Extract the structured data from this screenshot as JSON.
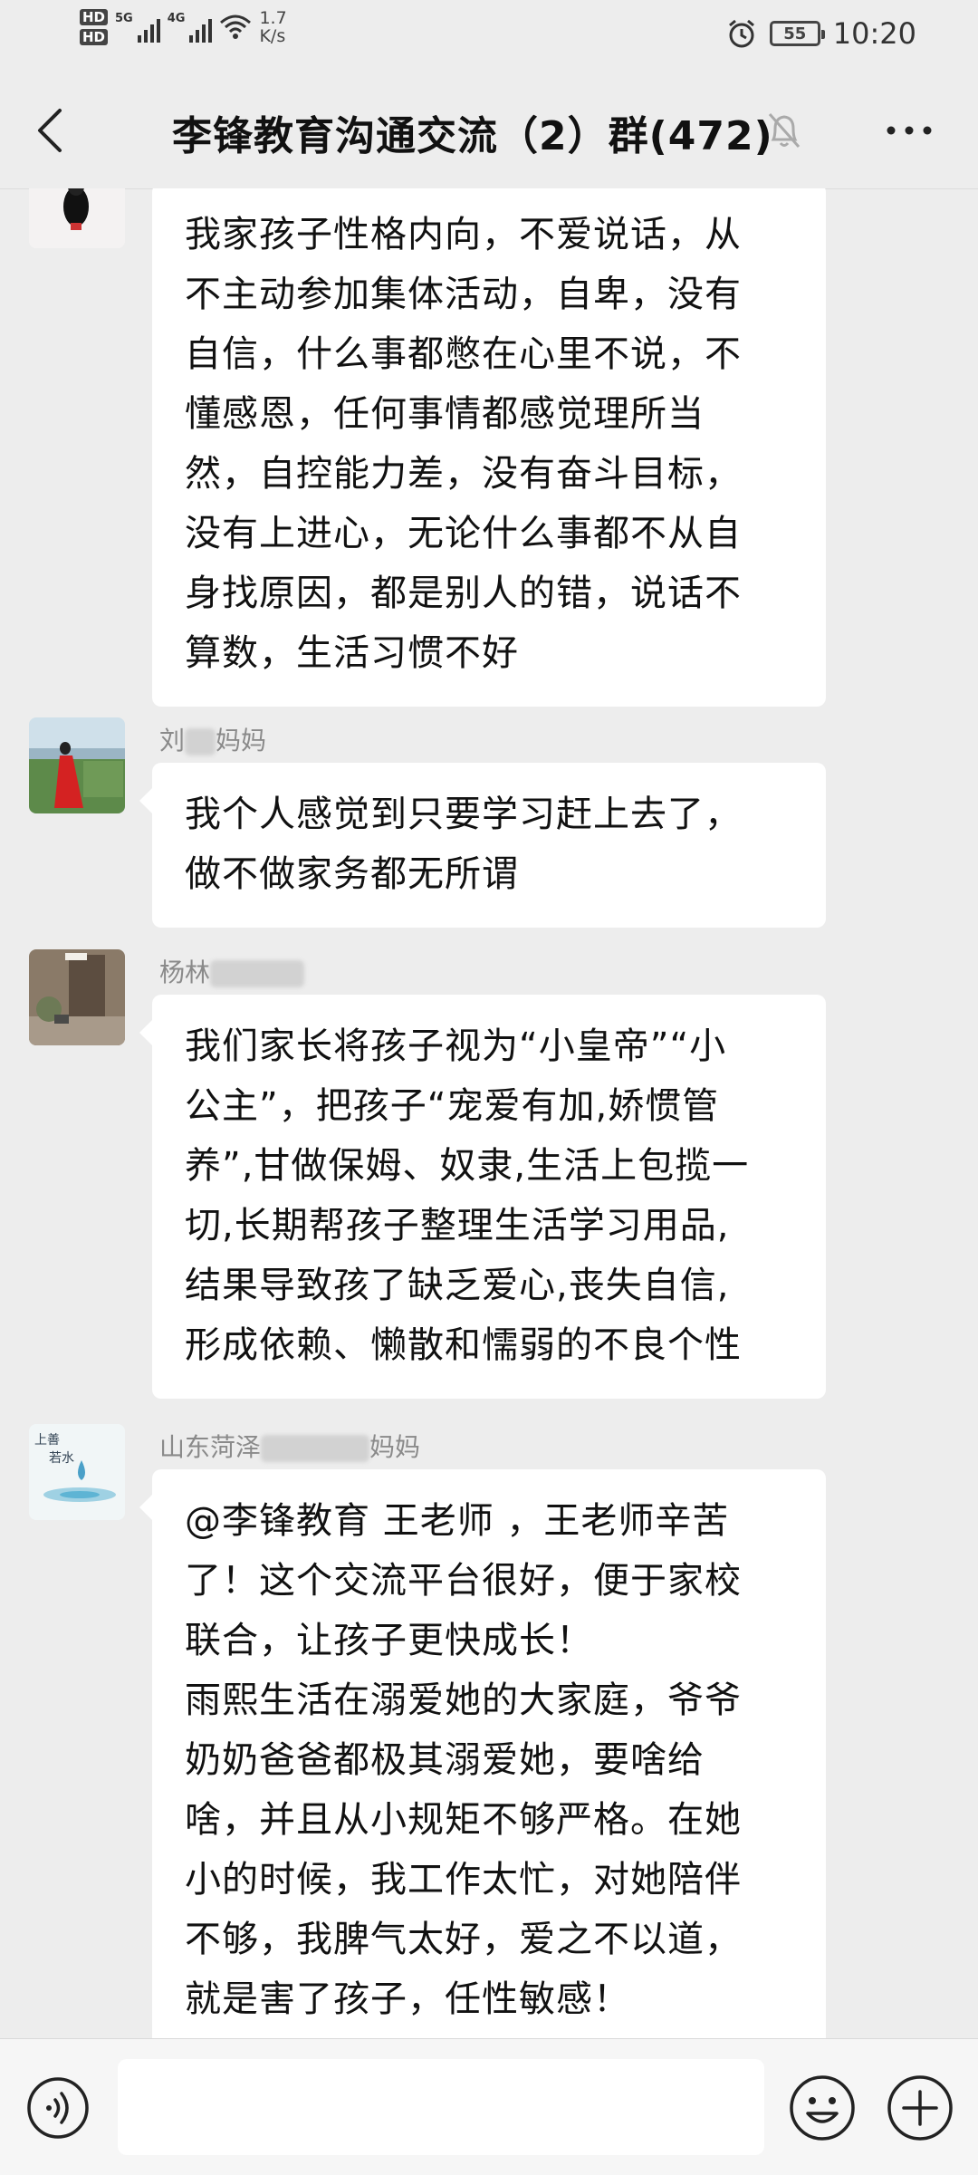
{
  "status_bar": {
    "hd1": "HD",
    "hd2": "HD",
    "net1": "5G",
    "net2": "4G",
    "speed_value": "1.7",
    "speed_unit": "K/s",
    "battery": "55",
    "time": "10:20"
  },
  "header": {
    "title": "李锋教育沟通交流（2）群(472)",
    "back_icon": "chevron-left-icon",
    "mute_icon": "bell-muted-icon",
    "more_icon": "more-dots-icon"
  },
  "messages": [
    {
      "sender": "",
      "text": "我家孩子性格内向，不爱说话，从\n不主动参加集体活动，自卑，没有\n自信，什么事都憋在心里不说，不\n懂感恩，任何事情都感觉理所当\n然，自控能力差，没有奋斗目标，\n没有上进心，无论什么事都不从自\n身找原因，都是别人的错，说话不\n算数，生活习惯不好"
    },
    {
      "sender_prefix": "刘",
      "sender_suffix": "妈妈",
      "text": "我个人感觉到只要学习赶上去了，\n做不做家务都无所谓"
    },
    {
      "sender_prefix": "杨林",
      "sender_suffix": "",
      "text": "我们家长将孩子视为“小皇帝”“小\n公主”，把孩子“宠爱有加,娇惯管\n养”,甘做保姆、奴隶,生活上包揽一\n切,长期帮孩子整理生活学习用品,\n结果导致孩了缺乏爱心,丧失自信,\n形成依赖、懒散和懦弱的不良个性"
    },
    {
      "sender_prefix": "山东菏泽",
      "sender_suffix": "妈妈",
      "avatar_text": "上善若水",
      "text": "@李锋教育 王老师 ，王老师辛苦\n了！这个交流平台很好，便于家校\n联合，让孩子更快成长！\n雨熙生活在溺爱她的大家庭，爷爷\n奶奶爸爸都极其溺爱她，要啥给\n啥，并且从小规矩不够严格。在她\n小的时候，我工作太忙，对她陪伴\n不够，我脾气太好，爱之不以道，\n就是害了孩子，任性敏感！"
    }
  ],
  "input_bar": {
    "voice_icon": "voice-icon",
    "emoji_icon": "emoji-icon",
    "plus_icon": "plus-circle-icon"
  },
  "colors": {
    "background": "#ededed",
    "bubble": "#ffffff",
    "sender_name": "#8a8a8a"
  }
}
